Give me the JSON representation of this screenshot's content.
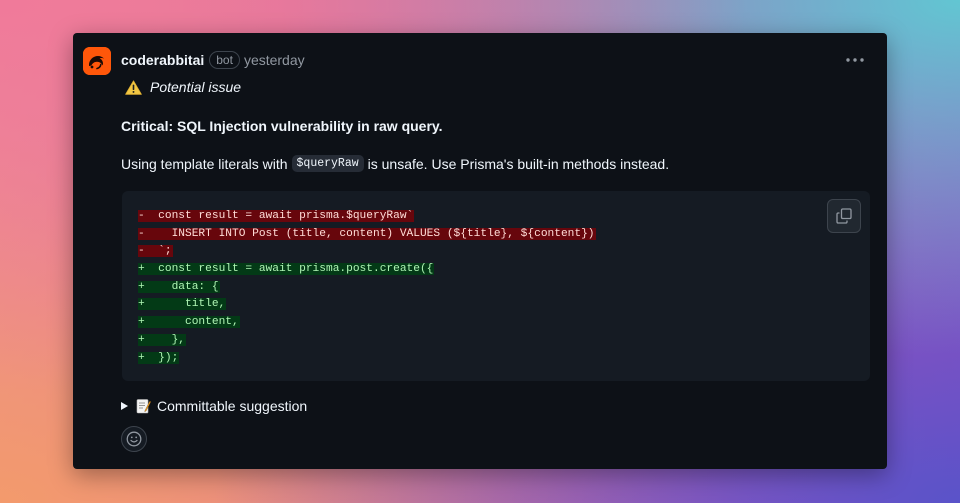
{
  "comment": {
    "author": "coderabbitai",
    "badge": "bot",
    "timestamp": "yesterday",
    "menu_icon": "kebab-horizontal-icon",
    "avatar_icon": "coderabbit-logo",
    "warning": {
      "icon": "warning-icon",
      "text": "Potential issue"
    },
    "title": "Critical: SQL Injection vulnerability in raw query.",
    "description": {
      "before": "Using template literals with",
      "code": "$queryRaw",
      "after": "is unsafe. Use Prisma's built-in methods instead."
    },
    "code_block": {
      "copy_icon": "copy-icon",
      "lines": [
        {
          "type": "del",
          "text": "-  const result = await prisma.$queryRaw`"
        },
        {
          "type": "del",
          "text": "-    INSERT INTO Post (title, content) VALUES (${title}, ${content})"
        },
        {
          "type": "del",
          "text": "-  `;"
        },
        {
          "type": "add",
          "text": "+  const result = await prisma.post.create({"
        },
        {
          "type": "add",
          "text": "+    data: {"
        },
        {
          "type": "add",
          "text": "+      title,"
        },
        {
          "type": "add",
          "text": "+      content,"
        },
        {
          "type": "add",
          "text": "+    },"
        },
        {
          "type": "add",
          "text": "+  });"
        }
      ]
    },
    "suggestion": {
      "icon": "memo-icon",
      "label": "Committable suggestion"
    },
    "reaction_icon": "smiley-icon"
  },
  "colors": {
    "card_bg": "#0d1117",
    "code_bg": "#151b23",
    "del_bg": "#67060c",
    "add_bg": "#033a16",
    "warning": "#d29922",
    "brand": "#ff570a"
  }
}
